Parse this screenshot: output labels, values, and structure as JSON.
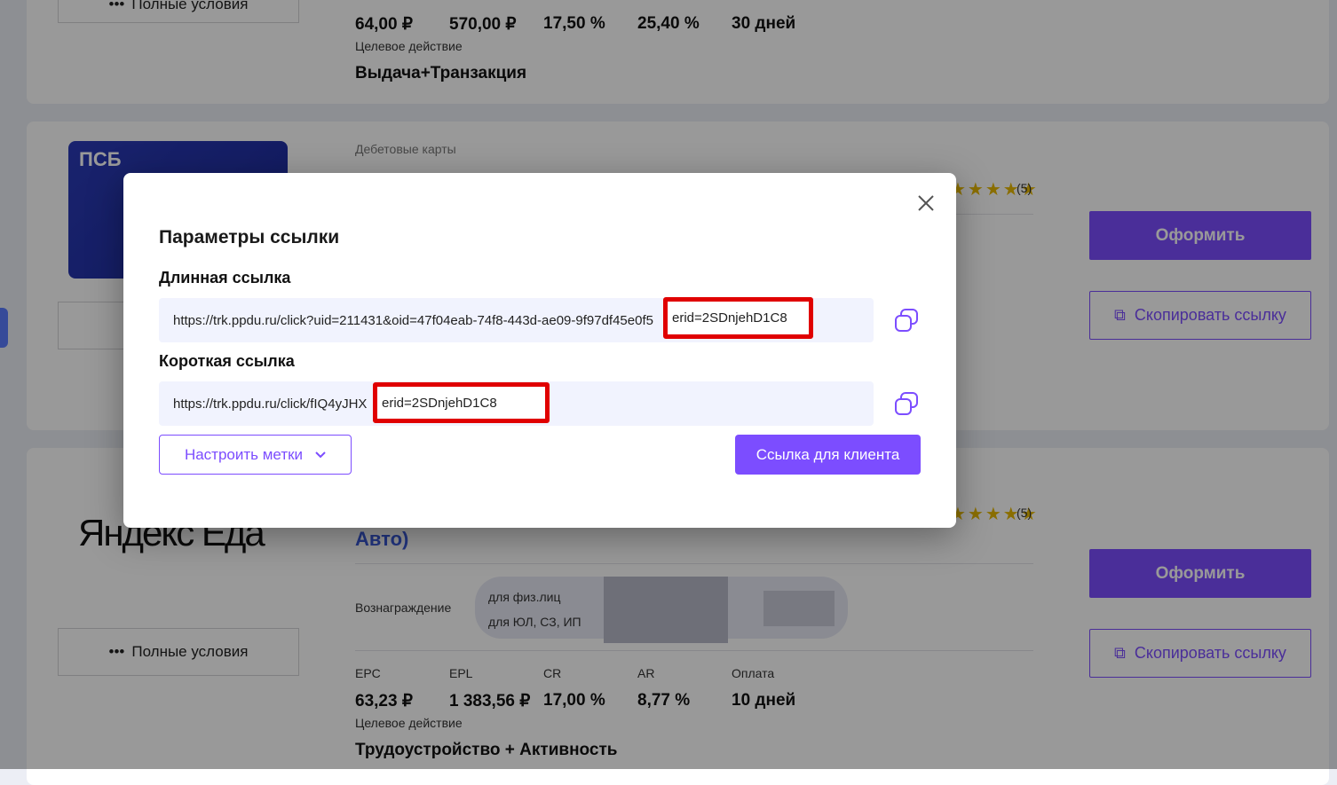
{
  "card1": {
    "terms_label": "Полные условия",
    "metrics": [
      {
        "value": "64,00 ₽"
      },
      {
        "value": "570,00 ₽"
      },
      {
        "value": "17,50 %"
      },
      {
        "value": "25,40 %"
      },
      {
        "value": "30 дней"
      }
    ],
    "target_label": "Целевое действие",
    "target_value": "Выдача+Транзакция"
  },
  "card2": {
    "logo_text": "ПСБ",
    "category": "Дебетовые карты",
    "rating_count": "(5)",
    "apply_label": "Оформить",
    "copy_label": "Скопировать ссылку"
  },
  "card3": {
    "logo_text": "Яндекс Еда",
    "title_fragment": "Авто)",
    "rating_count": "(5)",
    "reward_label": "Вознаграждение",
    "reward_rows": [
      "для физ.лиц",
      "для ЮЛ, СЗ, ИП"
    ],
    "terms_label": "Полные условия",
    "metric_headers": [
      "EPC",
      "EPL",
      "CR",
      "AR",
      "Оплата"
    ],
    "metrics": [
      {
        "value": "63,23 ₽"
      },
      {
        "value": "1 383,56 ₽"
      },
      {
        "value": "17,00 %"
      },
      {
        "value": "8,77 %"
      },
      {
        "value": "10 дней"
      }
    ],
    "target_label": "Целевое действие",
    "target_value": "Трудоустройство + Активность",
    "apply_label": "Оформить",
    "copy_label": "Скопировать ссылку"
  },
  "modal": {
    "title": "Параметры ссылки",
    "long_label": "Длинная ссылка",
    "long_url": "https://trk.ppdu.ru/click?uid=211431&oid=47f04eab-74f8-443d-ae09-9f97df45e0f5",
    "long_erid": "erid=2SDnjehD1C8",
    "short_label": "Короткая ссылка",
    "short_url": "https://trk.ppdu.ru/click/fIQ4yJHX",
    "short_erid": "erid=2SDnjehD1C8",
    "tags_button": "Настроить метки",
    "client_button": "Ссылка для клиента"
  },
  "colors": {
    "accent": "#7c4dff",
    "highlight": "#e00000",
    "field_bg": "#f1f3fe"
  }
}
